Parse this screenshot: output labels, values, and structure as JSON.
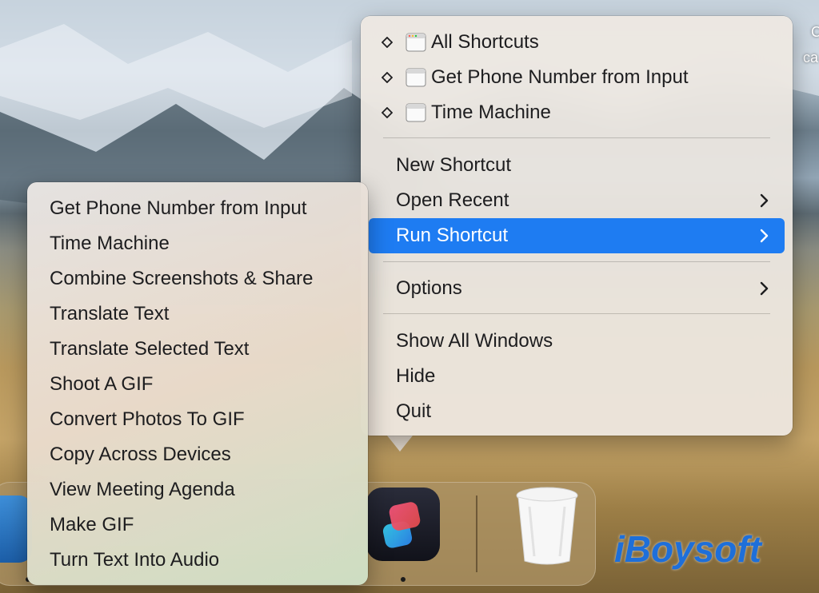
{
  "colors": {
    "accent": "#1e7cf2",
    "menu_bg": "#eee8e2",
    "watermark": "#1e6fd9"
  },
  "main_menu": {
    "shortcuts": [
      {
        "label": "All Shortcuts",
        "icon": "window-icon"
      },
      {
        "label": "Get Phone Number from Input",
        "icon": "window-icon"
      },
      {
        "label": "Time Machine",
        "icon": "window-icon"
      }
    ],
    "items": [
      {
        "label": "New Shortcut",
        "has_submenu": false
      },
      {
        "label": "Open Recent",
        "has_submenu": true
      },
      {
        "label": "Run Shortcut",
        "has_submenu": true,
        "highlighted": true
      },
      {
        "label": "Options",
        "has_submenu": true
      },
      {
        "label": "Show All Windows",
        "has_submenu": false
      },
      {
        "label": "Hide",
        "has_submenu": false
      },
      {
        "label": "Quit",
        "has_submenu": false
      }
    ]
  },
  "submenu": {
    "items": [
      "Get Phone Number from Input",
      "Time Machine",
      "Combine Screenshots & Share",
      "Translate Text",
      "Translate Selected Text",
      "Shoot A GIF",
      "Convert Photos To GIF",
      "Copy Across Devices",
      "View Meeting Agenda",
      "Make GIF",
      "Turn Text Into Audio"
    ]
  },
  "dock": {
    "apps": [
      {
        "name": "Shortcuts",
        "icon": "shortcuts-app-icon",
        "running": true
      },
      {
        "name": "Trash",
        "icon": "trash-icon",
        "running": false
      }
    ]
  },
  "watermark": {
    "text": "iBoysoft"
  },
  "corner_text": {
    "line1": "C",
    "line2": "ca"
  }
}
